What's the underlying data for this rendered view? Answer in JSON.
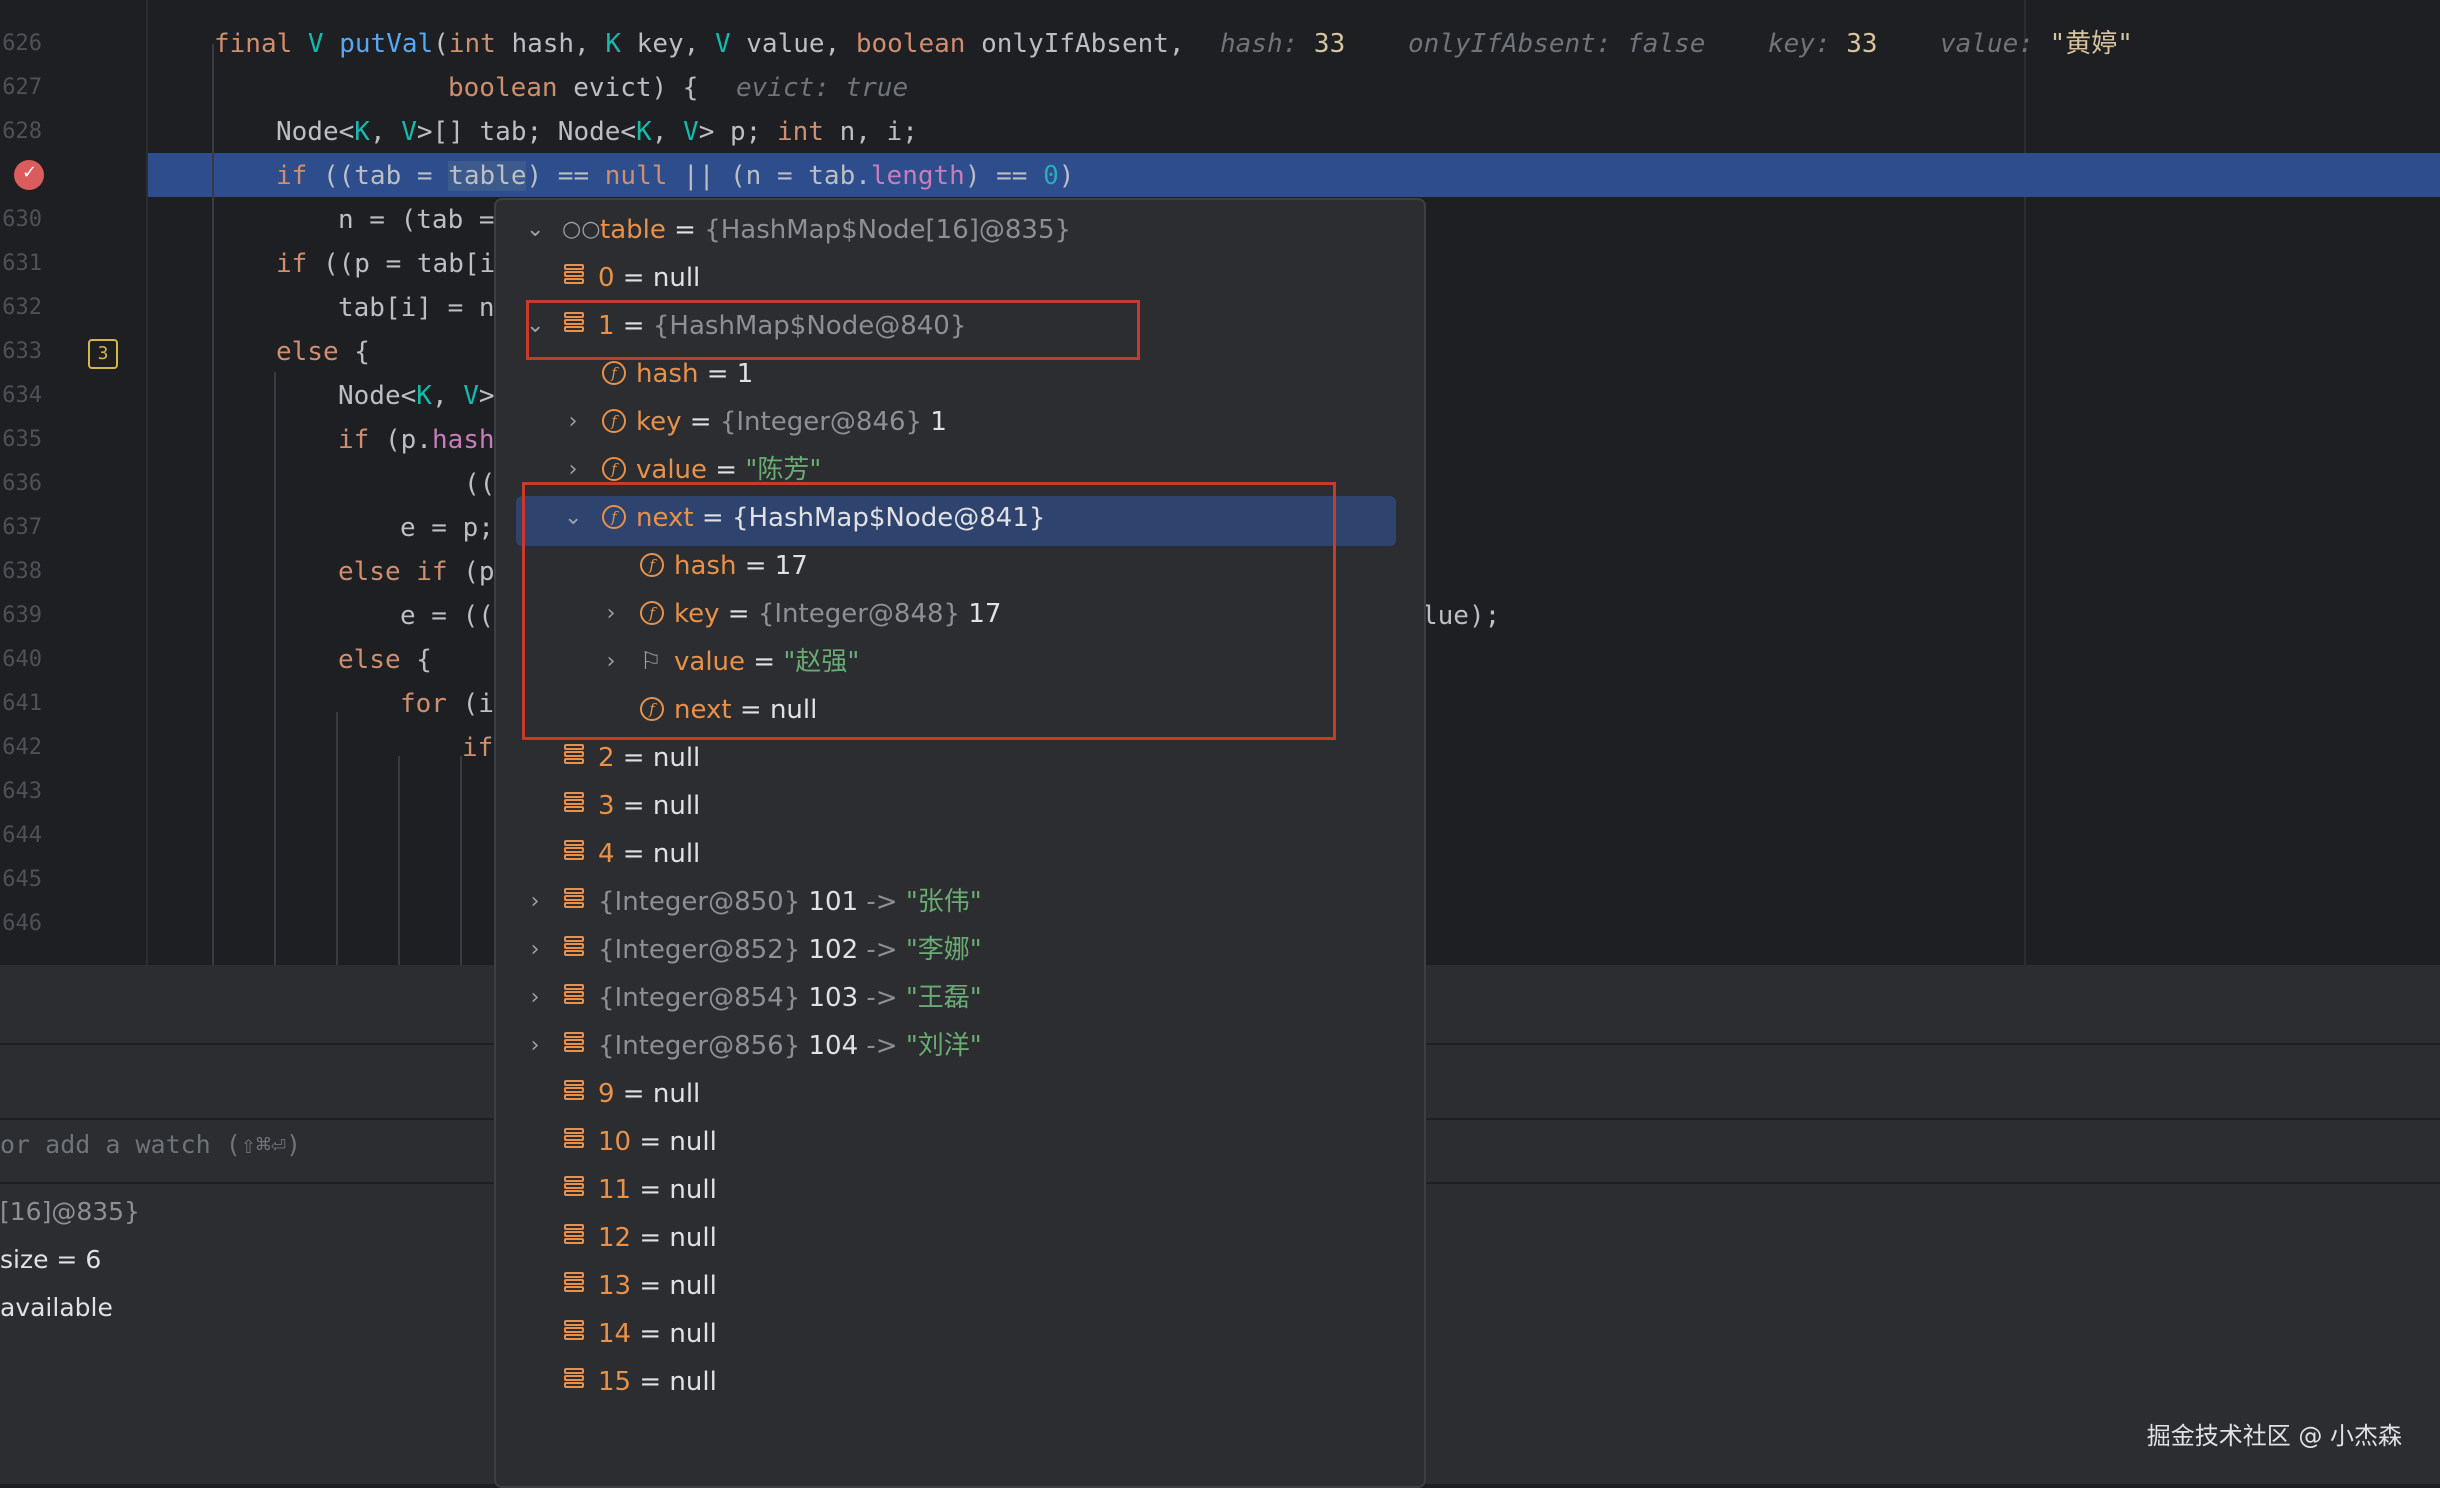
{
  "editor": {
    "lines": [
      {
        "num": "626",
        "code": "final V putVal(int hash, K key, V value, boolean onlyIfAbsent,"
      },
      {
        "num": "627",
        "code": "boolean evict) {"
      },
      {
        "num": "628",
        "code": "Node<K, V>[] tab; Node<K, V> p; int n, i;"
      },
      {
        "num": "629",
        "code": "if ((tab = table) == null || (n = tab.length) == 0)"
      },
      {
        "num": "630",
        "code": "n = (tab ="
      },
      {
        "num": "631",
        "code": "if ((p = tab[i"
      },
      {
        "num": "632",
        "code": "tab[i] = n"
      },
      {
        "num": "633",
        "code": "else {"
      },
      {
        "num": "634",
        "code": "Node<K, V>"
      },
      {
        "num": "635",
        "code": "if (p.hash"
      },
      {
        "num": "636",
        "code": "(("
      },
      {
        "num": "637",
        "code": "e = p;"
      },
      {
        "num": "638",
        "code": "else if (p"
      },
      {
        "num": "639",
        "code": "e = (("
      },
      {
        "num": "640",
        "code": "else {"
      },
      {
        "num": "641",
        "code": "for (i"
      },
      {
        "num": "642",
        "code": "if"
      },
      {
        "num": "643",
        "code": ""
      },
      {
        "num": "644",
        "code": ""
      },
      {
        "num": "645",
        "code": ""
      },
      {
        "num": "646",
        "code": ""
      }
    ],
    "inline_hints": {
      "hash": "hash: 33",
      "only_if_absent": "onlyIfAbsent: false",
      "key": "key: 33",
      "value_label": "value:",
      "value_val": "\"黄婷\"",
      "evict": "evict: true"
    },
    "line639_tail": "lue);",
    "badge": "3"
  },
  "popup": {
    "root": {
      "name": "table",
      "eq": " = ",
      "ref": "{HashMap$Node[16]@835}"
    },
    "rows": [
      {
        "name": "0",
        "eq": " = ",
        "val": "null"
      },
      {
        "name": "1",
        "eq": " = ",
        "ref": "{HashMap$Node@840}"
      },
      {
        "name": "hash",
        "eq": " = ",
        "val": "1"
      },
      {
        "name": "key",
        "eq": " = ",
        "ref": "{Integer@846}",
        "val": " 1"
      },
      {
        "name": "value",
        "eq": " = ",
        "str": "\"陈芳\""
      },
      {
        "name": "next",
        "eq": " = ",
        "val": "{HashMap$Node@841}"
      },
      {
        "name": "hash",
        "eq": " = ",
        "val": "17"
      },
      {
        "name": "key",
        "eq": " = ",
        "ref": "{Integer@848}",
        "val": " 17"
      },
      {
        "name": "value",
        "eq": " = ",
        "str": "\"赵强\""
      },
      {
        "name": "next",
        "eq": " = ",
        "val": "null"
      },
      {
        "name": "2",
        "eq": " = ",
        "val": "null"
      },
      {
        "name": "3",
        "eq": " = ",
        "val": "null"
      },
      {
        "name": "4",
        "eq": " = ",
        "val": "null"
      },
      {
        "ref": "{Integer@850}",
        "val": " 101 ",
        "arrow": "->",
        "str": " \"张伟\""
      },
      {
        "ref": "{Integer@852}",
        "val": " 102 ",
        "arrow": "->",
        "str": " \"李娜\""
      },
      {
        "ref": "{Integer@854}",
        "val": " 103 ",
        "arrow": "->",
        "str": " \"王磊\""
      },
      {
        "ref": "{Integer@856}",
        "val": " 104 ",
        "arrow": "->",
        "str": " \"刘洋\""
      },
      {
        "name": "9",
        "eq": " = ",
        "val": "null"
      },
      {
        "name": "10",
        "eq": " = ",
        "val": "null"
      },
      {
        "name": "11",
        "eq": " = ",
        "val": "null"
      },
      {
        "name": "12",
        "eq": " = ",
        "val": "null"
      },
      {
        "name": "13",
        "eq": " = ",
        "val": "null"
      },
      {
        "name": "14",
        "eq": " = ",
        "val": "null"
      },
      {
        "name": "15",
        "eq": " = ",
        "val": "null"
      }
    ]
  },
  "bottom": {
    "watch_placeholder": "or add a watch (⇧⌘⏎)",
    "vars": [
      "[16]@835}",
      "size = 6",
      "available"
    ],
    "watermark": "掘金技术社区 @ 小杰森"
  },
  "colors": {
    "accent": "#2e4d8c",
    "selection": "#2e436e",
    "highlight_box": "#c63b2c",
    "field_icon": "#e7914a"
  }
}
